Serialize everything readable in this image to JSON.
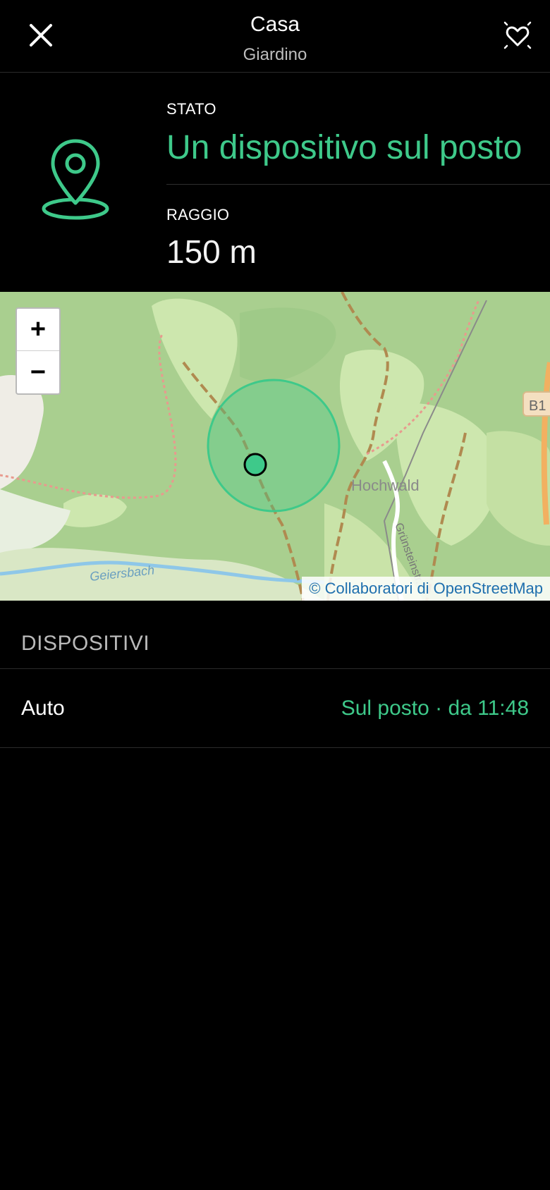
{
  "header": {
    "title": "Casa",
    "subtitle": "Giardino",
    "close_icon": "close-icon",
    "favorite_icon": "heart-sparkle-icon"
  },
  "info": {
    "pin_icon": "location-pin-icon",
    "stato_label": "STATO",
    "stato_value": "Un dispositivo sul posto",
    "raggio_label": "RAGGIO",
    "raggio_value": "150 m"
  },
  "map": {
    "zoom_in_label": "+",
    "zoom_out_label": "−",
    "place_label": "Hochwald",
    "stream_label": "Geiersbach",
    "street_label": "Grünsteinstr.",
    "road_badge": "B1",
    "attribution": "© Collaboratori di OpenStreetMap"
  },
  "devices": {
    "section_title": "DISPOSITIVI",
    "items": [
      {
        "name": "Auto",
        "status": "Sul posto · da 11:48"
      }
    ]
  },
  "colors": {
    "accent": "#3ec98a",
    "background": "#000000",
    "muted_text": "#b9b9b9"
  }
}
